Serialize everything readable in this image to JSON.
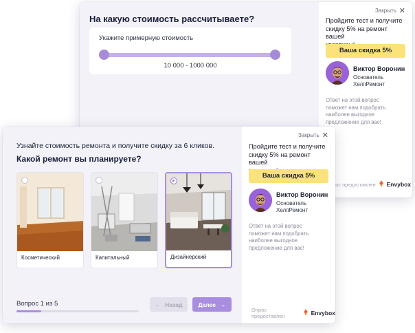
{
  "back": {
    "title": "На какую стоимость рассчитываете?",
    "card_label": "Укажите примерную стоимость",
    "range_value": "10 000 - 1000 000",
    "side": {
      "close": "Закрыть",
      "promo_line1": "Пройдите тест и получите",
      "promo_line2": "скидку 5% на ремонт вашей",
      "promo_line3": "квартиры!",
      "discount": "Ваша скидка 5%",
      "name": "Виктор Воронин",
      "role_line1": "Основатель",
      "role_line2": "ХелпРемонт",
      "note_line1": "Ответ на этой вопрос",
      "note_line2": "поможет нам подобрать",
      "note_line3": "наиболее выгодное",
      "note_line4": "предложение для вас!",
      "powered": "Опрос предоставлен",
      "brand": "Envybox"
    }
  },
  "front": {
    "intro": "Узнайте стоимость ремонта и получите скидку за 6 кликов.",
    "question": "Какой ремонт вы планируете?",
    "options": [
      {
        "label": "Косметический",
        "selected": false
      },
      {
        "label": "Капитальный",
        "selected": false
      },
      {
        "label": "Дизайнерский",
        "selected": true
      }
    ],
    "progress": "Вопрос 1 из 5",
    "progress_fraction": 0.2,
    "back_label": "Назад",
    "next_label": "Далее",
    "side": {
      "close": "Закрыть",
      "promo_line1": "Пройдите тест и получите",
      "promo_line2": "скидку 5% на ремонт вашей",
      "promo_line3": "квартиры!",
      "discount": "Ваша скидка 5%",
      "name": "Виктор Воронин",
      "role_line1": "Основатель",
      "role_line2": "ХелпРемонт",
      "note_line1": "Ответ на этой вопрос",
      "note_line2": "поможет нам подобрать",
      "note_line3": "наиболее выгодное",
      "note_line4": "предложение для вас!",
      "powered": "Опрос предоставлен",
      "brand": "Envybox"
    }
  },
  "colors": {
    "accent": "#a98ee0",
    "discount_bg": "#fbe27a",
    "panel_bg": "#f3f2f8"
  },
  "icons": [
    "close-icon",
    "arrow-left-icon",
    "arrow-right-icon",
    "envybox-logo-icon"
  ]
}
